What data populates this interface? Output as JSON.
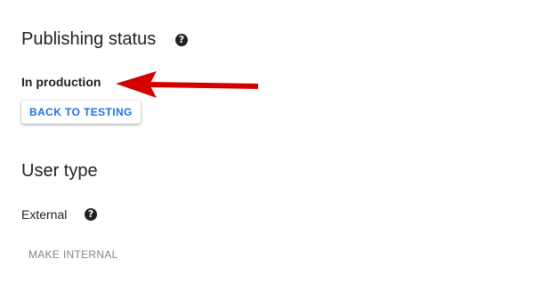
{
  "publishing": {
    "title": "Publishing status",
    "help_glyph": "?",
    "help_icon": "help-circle-icon",
    "status": "In production",
    "back_to_testing_label": "BACK TO TESTING"
  },
  "user_type": {
    "title": "User type",
    "value": "External",
    "help_glyph": "?",
    "help_icon": "help-circle-icon",
    "make_internal_label": "MAKE INTERNAL",
    "make_internal_disabled": true
  },
  "annotation": {
    "arrow_color": "#d40000",
    "arrow_icon": "arrow-left-icon"
  },
  "colors": {
    "primary": "#1a73e8",
    "text": "#202124",
    "disabled_text": "#80868b"
  }
}
